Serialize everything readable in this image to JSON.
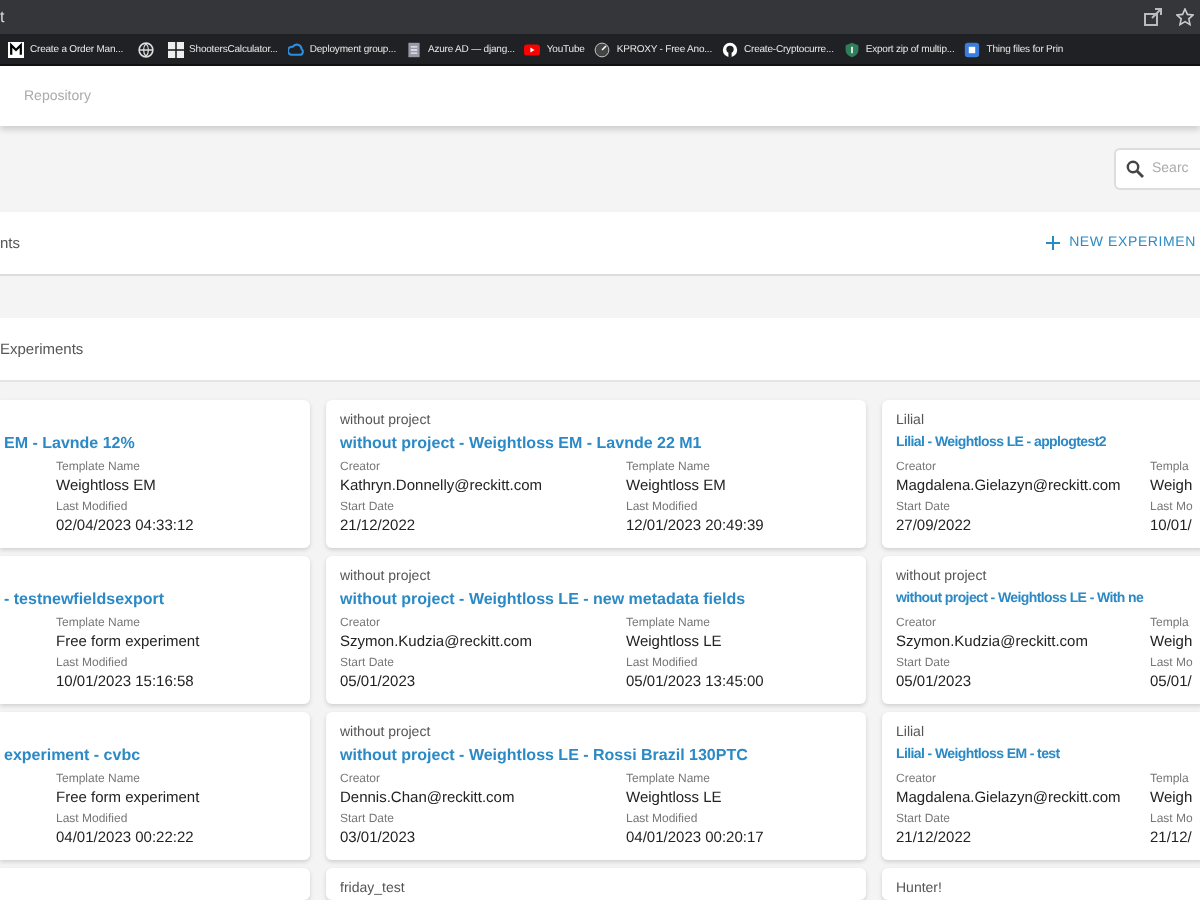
{
  "browser": {
    "tab_fragment": "t",
    "bookmarks": [
      {
        "label": "Create a Order Man..."
      },
      {
        "kind": "icon-only"
      },
      {
        "label": "ShootersCalculator..."
      },
      {
        "label": "Deployment group..."
      },
      {
        "label": "Azure AD — djang..."
      },
      {
        "label": "YouTube"
      },
      {
        "label": "KPROXY - Free Ano..."
      },
      {
        "label": "Create-Cryptocurre..."
      },
      {
        "label": "Export zip of multip..."
      },
      {
        "label": "Thing files for Prin"
      }
    ]
  },
  "header": {
    "breadcrumb": "Repository"
  },
  "search": {
    "placeholder": "Searc"
  },
  "toolbar": {
    "title": "nts",
    "button": "NEW EXPERIMEN"
  },
  "section": {
    "title": "Experiments"
  },
  "cards": [
    {
      "kind": "left-cut",
      "title": "EM - Lavnde 12%",
      "fields": [
        {
          "label": "Template Name",
          "value": "Weightloss EM"
        },
        {
          "label": "Last Modified",
          "value": "02/04/2023 04:33:12"
        }
      ]
    },
    {
      "kind": "full",
      "project": "without project",
      "title": "without project - Weightloss EM - Lavnde 22 M1",
      "fields": [
        {
          "label": "Creator",
          "value": "Kathryn.Donnelly@reckitt.com"
        },
        {
          "label": "Template Name",
          "value": "Weightloss EM"
        },
        {
          "label": "Start Date",
          "value": "21/12/2022"
        },
        {
          "label": "Last Modified",
          "value": "12/01/2023 20:49:39"
        }
      ]
    },
    {
      "kind": "right-cut",
      "project": "Lilial",
      "title": "Lilial - Weightloss LE - applogtest2",
      "fields": [
        {
          "label": "Creator",
          "value": "Magdalena.Gielazyn@reckitt.com"
        },
        {
          "label": "Templa",
          "value": "Weigh"
        },
        {
          "label": "Start Date",
          "value": "27/09/2022"
        },
        {
          "label": "Last Mo",
          "value": "10/01/"
        }
      ]
    },
    {
      "kind": "left-cut",
      "title": "- testnewfieldsexport",
      "fields": [
        {
          "label": "Template Name",
          "value": "Free form experiment"
        },
        {
          "label": "Last Modified",
          "value": "10/01/2023 15:16:58"
        }
      ]
    },
    {
      "kind": "full",
      "project": "without project",
      "title": "without project - Weightloss LE - new metadata fields",
      "fields": [
        {
          "label": "Creator",
          "value": "Szymon.Kudzia@reckitt.com"
        },
        {
          "label": "Template Name",
          "value": "Weightloss LE"
        },
        {
          "label": "Start Date",
          "value": "05/01/2023"
        },
        {
          "label": "Last Modified",
          "value": "05/01/2023 13:45:00"
        }
      ]
    },
    {
      "kind": "right-cut",
      "project": "without project",
      "title": "without project - Weightloss LE - With ne",
      "fields": [
        {
          "label": "Creator",
          "value": "Szymon.Kudzia@reckitt.com"
        },
        {
          "label": "Templa",
          "value": "Weigh"
        },
        {
          "label": "Start Date",
          "value": "05/01/2023"
        },
        {
          "label": "Last Mo",
          "value": "05/01/"
        }
      ]
    },
    {
      "kind": "left-cut",
      "title": "experiment - cvbc",
      "fields": [
        {
          "label": "Template Name",
          "value": "Free form experiment"
        },
        {
          "label": "Last Modified",
          "value": "04/01/2023 00:22:22"
        }
      ]
    },
    {
      "kind": "full",
      "project": "without project",
      "title": "without project - Weightloss LE - Rossi Brazil 130PTC",
      "fields": [
        {
          "label": "Creator",
          "value": "Dennis.Chan@reckitt.com"
        },
        {
          "label": "Template Name",
          "value": "Weightloss LE"
        },
        {
          "label": "Start Date",
          "value": "03/01/2023"
        },
        {
          "label": "Last Modified",
          "value": "04/01/2023 00:20:17"
        }
      ]
    },
    {
      "kind": "right-cut",
      "project": "Lilial",
      "title": "Lilial - Weightloss EM - test",
      "fields": [
        {
          "label": "Creator",
          "value": "Magdalena.Gielazyn@reckitt.com"
        },
        {
          "label": "Templa",
          "value": "Weigh"
        },
        {
          "label": "Start Date",
          "value": "21/12/2022"
        },
        {
          "label": "Last Mo",
          "value": "21/12/"
        }
      ]
    },
    {
      "kind": "blank"
    },
    {
      "kind": "full",
      "project": "friday_test"
    },
    {
      "kind": "right-cut",
      "project": "Hunter!"
    }
  ]
}
